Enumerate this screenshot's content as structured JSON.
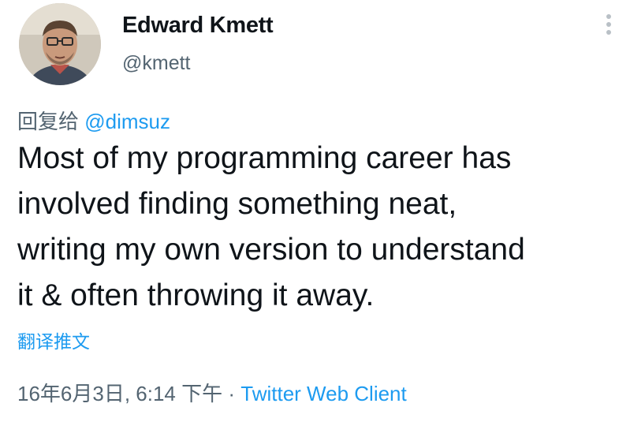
{
  "author": {
    "name": "Edward Kmett",
    "handle": "@kmett",
    "avatar_icon": "avatar-photo"
  },
  "reply": {
    "prefix": "回复给",
    "mention": "@dimsuz"
  },
  "tweet": {
    "lines": [
      "Most of my programming career has",
      "involved finding something neat,",
      "writing my own version to understand",
      "it & often throwing it away."
    ]
  },
  "translate_label": "翻译推文",
  "meta": {
    "timestamp": "16年6月3日, 6:14 下午",
    "separator": "·",
    "source": "Twitter Web Client"
  },
  "colors": {
    "link": "#1d9bf0",
    "secondary_text": "#536471",
    "primary_text": "#0f1419"
  }
}
